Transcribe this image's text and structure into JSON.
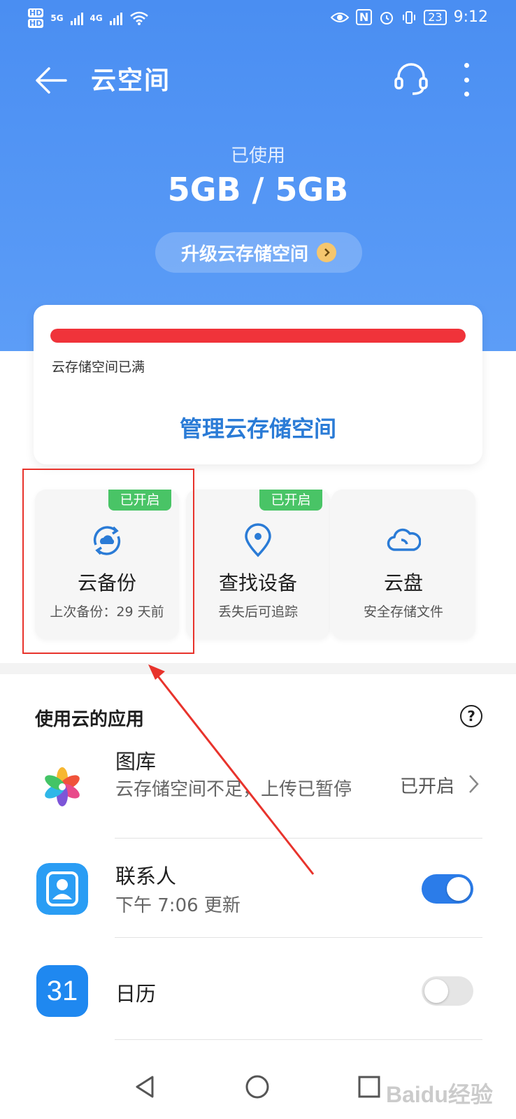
{
  "status_bar": {
    "hd1": "HD",
    "hd2": "HD",
    "net1": "5G",
    "net2": "4G",
    "nfc": "N",
    "battery": "23",
    "time": "9:12"
  },
  "header": {
    "title": "云空间"
  },
  "usage": {
    "label": "已使用",
    "value": "5GB / 5GB",
    "upgrade_label": "升级云存储空间",
    "fill_fraction": 1.0
  },
  "storage_card": {
    "status_text": "云存储空间已满",
    "manage_label": "管理云存储空间"
  },
  "tiles": [
    {
      "badge": "已开启",
      "name": "云备份",
      "sub": "上次备份：29 天前",
      "icon": "cloud-sync-icon"
    },
    {
      "badge": "已开启",
      "name": "查找设备",
      "sub": "丢失后可追踪",
      "icon": "location-pin-icon"
    },
    {
      "badge": "",
      "name": "云盘",
      "sub": "安全存储文件",
      "icon": "cloud-icon"
    }
  ],
  "apps_section": {
    "title": "使用云的应用",
    "help": "?"
  },
  "apps": [
    {
      "name": "图库",
      "sub": "云存储空间不足，上传已暂停",
      "status": "已开启",
      "icon": "gallery-icon"
    },
    {
      "name": "联系人",
      "sub": "下午 7:06 更新",
      "toggle": "on",
      "icon": "contacts-icon"
    },
    {
      "name": "日历",
      "sub": "",
      "toggle": "off",
      "icon": "calendar-icon",
      "icon_text": "31"
    }
  ],
  "colors": {
    "header_blue": "#4a8ef2",
    "progress_red": "#f0333a",
    "badge_green": "#49c466",
    "link_blue": "#2a7bd6",
    "toggle_blue": "#2b7ce9",
    "annotation_red": "#e8332c"
  },
  "watermark": "Baidu经验"
}
